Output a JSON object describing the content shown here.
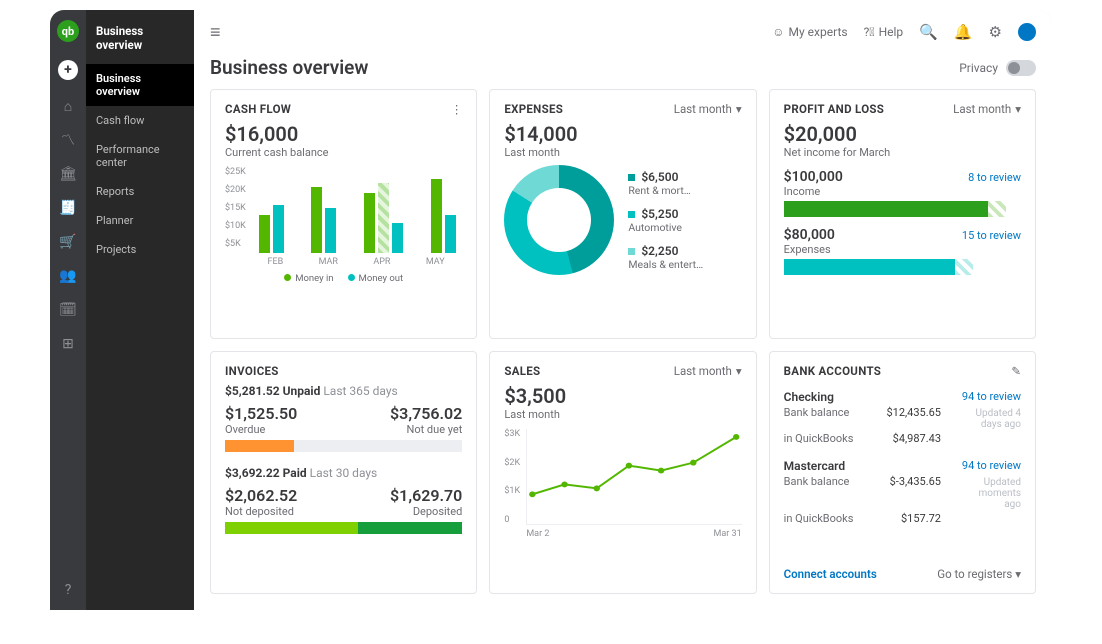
{
  "topbar": {
    "my_experts": "My experts",
    "help": "Help"
  },
  "subnav": {
    "header": "Business overview",
    "items": [
      "Business overview",
      "Cash flow",
      "Performance center",
      "Reports",
      "Planner",
      "Projects"
    ],
    "active": 0
  },
  "page": {
    "title": "Business overview",
    "privacy_label": "Privacy"
  },
  "cashflow": {
    "title": "CASH FLOW",
    "amount": "$16,000",
    "subtitle": "Current cash balance",
    "yticks": [
      "$25K",
      "$20K",
      "$15K",
      "$10K",
      "$5K"
    ],
    "legend_in": "Money in",
    "legend_out": "Money out",
    "months": [
      "FEB",
      "MAR",
      "APR",
      "MAY"
    ]
  },
  "expenses": {
    "title": "EXPENSES",
    "period": "Last month",
    "amount": "$14,000",
    "subtitle": "Last month",
    "items": [
      {
        "amount": "$6,500",
        "label": "Rent & mort…",
        "color": "#009e9b"
      },
      {
        "amount": "$5,250",
        "label": "Automotive",
        "color": "#00c1bf"
      },
      {
        "amount": "$2,250",
        "label": "Meals & entert…",
        "color": "#6fd9d6"
      }
    ]
  },
  "profitloss": {
    "title": "PROFIT AND LOSS",
    "period": "Last month",
    "amount": "$20,000",
    "subtitle": "Net income for March",
    "income": {
      "value": "$100,000",
      "label": "Income",
      "review": "8 to review",
      "color": "#2ca01c",
      "pct": 86
    },
    "expenses": {
      "value": "$80,000",
      "label": "Expenses",
      "review": "15 to review",
      "color": "#00c1bf",
      "pct": 72
    }
  },
  "invoices": {
    "title": "INVOICES",
    "unpaid": {
      "total": "$5,281.52 Unpaid",
      "range": "Last 365 days",
      "left_val": "$1,525.50",
      "left_lbl": "Overdue",
      "right_val": "$3,756.02",
      "right_lbl": "Not due yet",
      "pct": 29,
      "color": "#ff9331"
    },
    "paid": {
      "total": "$3,692.22 Paid",
      "range": "Last 30 days",
      "left_val": "$2,062.52",
      "left_lbl": "Not deposited",
      "right_val": "$1,629.70",
      "right_lbl": "Deposited",
      "pct": 56,
      "c1": "#7fd000",
      "c2": "#169e3c"
    }
  },
  "sales": {
    "title": "SALES",
    "period": "Last month",
    "amount": "$3,500",
    "subtitle": "Last month",
    "yticks": [
      "$3K",
      "$2K",
      "$1K",
      "0"
    ],
    "x_start": "Mar 2",
    "x_end": "Mar 31"
  },
  "bank": {
    "title": "BANK ACCOUNTS",
    "accounts": [
      {
        "name": "Checking",
        "review": "94 to review",
        "rows": [
          {
            "lbl": "Bank balance",
            "val": "$12,435.65",
            "upd": "Updated 4 days ago"
          },
          {
            "lbl": "in QuickBooks",
            "val": "$4,987.43",
            "upd": ""
          }
        ]
      },
      {
        "name": "Mastercard",
        "review": "94 to review",
        "rows": [
          {
            "lbl": "Bank balance",
            "val": "$-3,435.65",
            "upd": "Updated moments ago"
          },
          {
            "lbl": "in QuickBooks",
            "val": "$157.72",
            "upd": ""
          }
        ]
      }
    ],
    "connect": "Connect accounts",
    "goto": "Go to registers"
  },
  "chart_data": [
    {
      "type": "bar",
      "title": "Cash Flow",
      "categories": [
        "FEB",
        "MAR",
        "APR",
        "MAY"
      ],
      "series": [
        {
          "name": "Money in (solid)",
          "values": [
            11000,
            19000,
            17000,
            21000
          ]
        },
        {
          "name": "Money in (projected)",
          "values": [
            0,
            0,
            20000,
            0
          ]
        },
        {
          "name": "Money out",
          "values": [
            14000,
            13000,
            9000,
            11000
          ]
        }
      ],
      "ylim": [
        0,
        25000
      ],
      "xlabel": "",
      "ylabel": ""
    },
    {
      "type": "pie",
      "title": "Expenses Last month",
      "categories": [
        "Rent & mortgage",
        "Automotive",
        "Meals & entertainment"
      ],
      "values": [
        6500,
        5250,
        2250
      ]
    },
    {
      "type": "bar",
      "title": "Profit and Loss — Last month",
      "categories": [
        "Income",
        "Expenses"
      ],
      "values": [
        100000,
        80000
      ]
    },
    {
      "type": "line",
      "title": "Sales Last month",
      "x": [
        "Mar 2",
        "Mar 7",
        "Mar 12",
        "Mar 17",
        "Mar 22",
        "Mar 27",
        "Mar 31"
      ],
      "values": [
        1100,
        1400,
        1300,
        2100,
        1900,
        2200,
        3100
      ],
      "ylim": [
        0,
        3500
      ],
      "xlabel": "",
      "ylabel": ""
    }
  ]
}
